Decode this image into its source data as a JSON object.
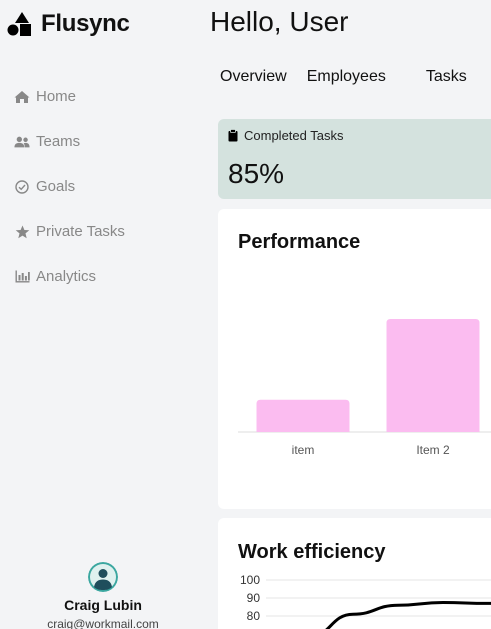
{
  "brand": {
    "name": "Flusync",
    "logo_icon": "shapes-logo-icon"
  },
  "sidebar": {
    "items": [
      {
        "label": "Home",
        "icon": "home-icon"
      },
      {
        "label": "Teams",
        "icon": "users-icon"
      },
      {
        "label": "Goals",
        "icon": "check-circle-icon"
      },
      {
        "label": "Private Tasks",
        "icon": "star-icon"
      },
      {
        "label": "Analytics",
        "icon": "bar-chart-icon"
      }
    ]
  },
  "profile": {
    "name": "Craig Lubin",
    "email": "craig@workmail.com"
  },
  "header": {
    "greeting": "Hello, User"
  },
  "tabs": [
    {
      "label": "Overview"
    },
    {
      "label": "Employees"
    },
    {
      "label": "Tasks"
    }
  ],
  "stat": {
    "label": "Completed Tasks",
    "value": "85%",
    "icon": "clipboard-icon"
  },
  "performance": {
    "title": "Performance",
    "chart_data": {
      "type": "bar",
      "title": "Performance",
      "categories": [
        "item",
        "Item 2"
      ],
      "values": [
        30,
        105
      ],
      "color": "#fbbcf0"
    }
  },
  "efficiency": {
    "title": "Work efficiency",
    "chart_data": {
      "type": "line",
      "title": "Work efficiency",
      "yticks": [
        100,
        90,
        80
      ],
      "ylim": [
        70,
        100
      ],
      "x": [
        0,
        1,
        2,
        3,
        4,
        5,
        6
      ],
      "y": [
        60,
        68,
        81,
        86,
        87.5,
        87,
        86
      ],
      "color": "#000000"
    }
  }
}
